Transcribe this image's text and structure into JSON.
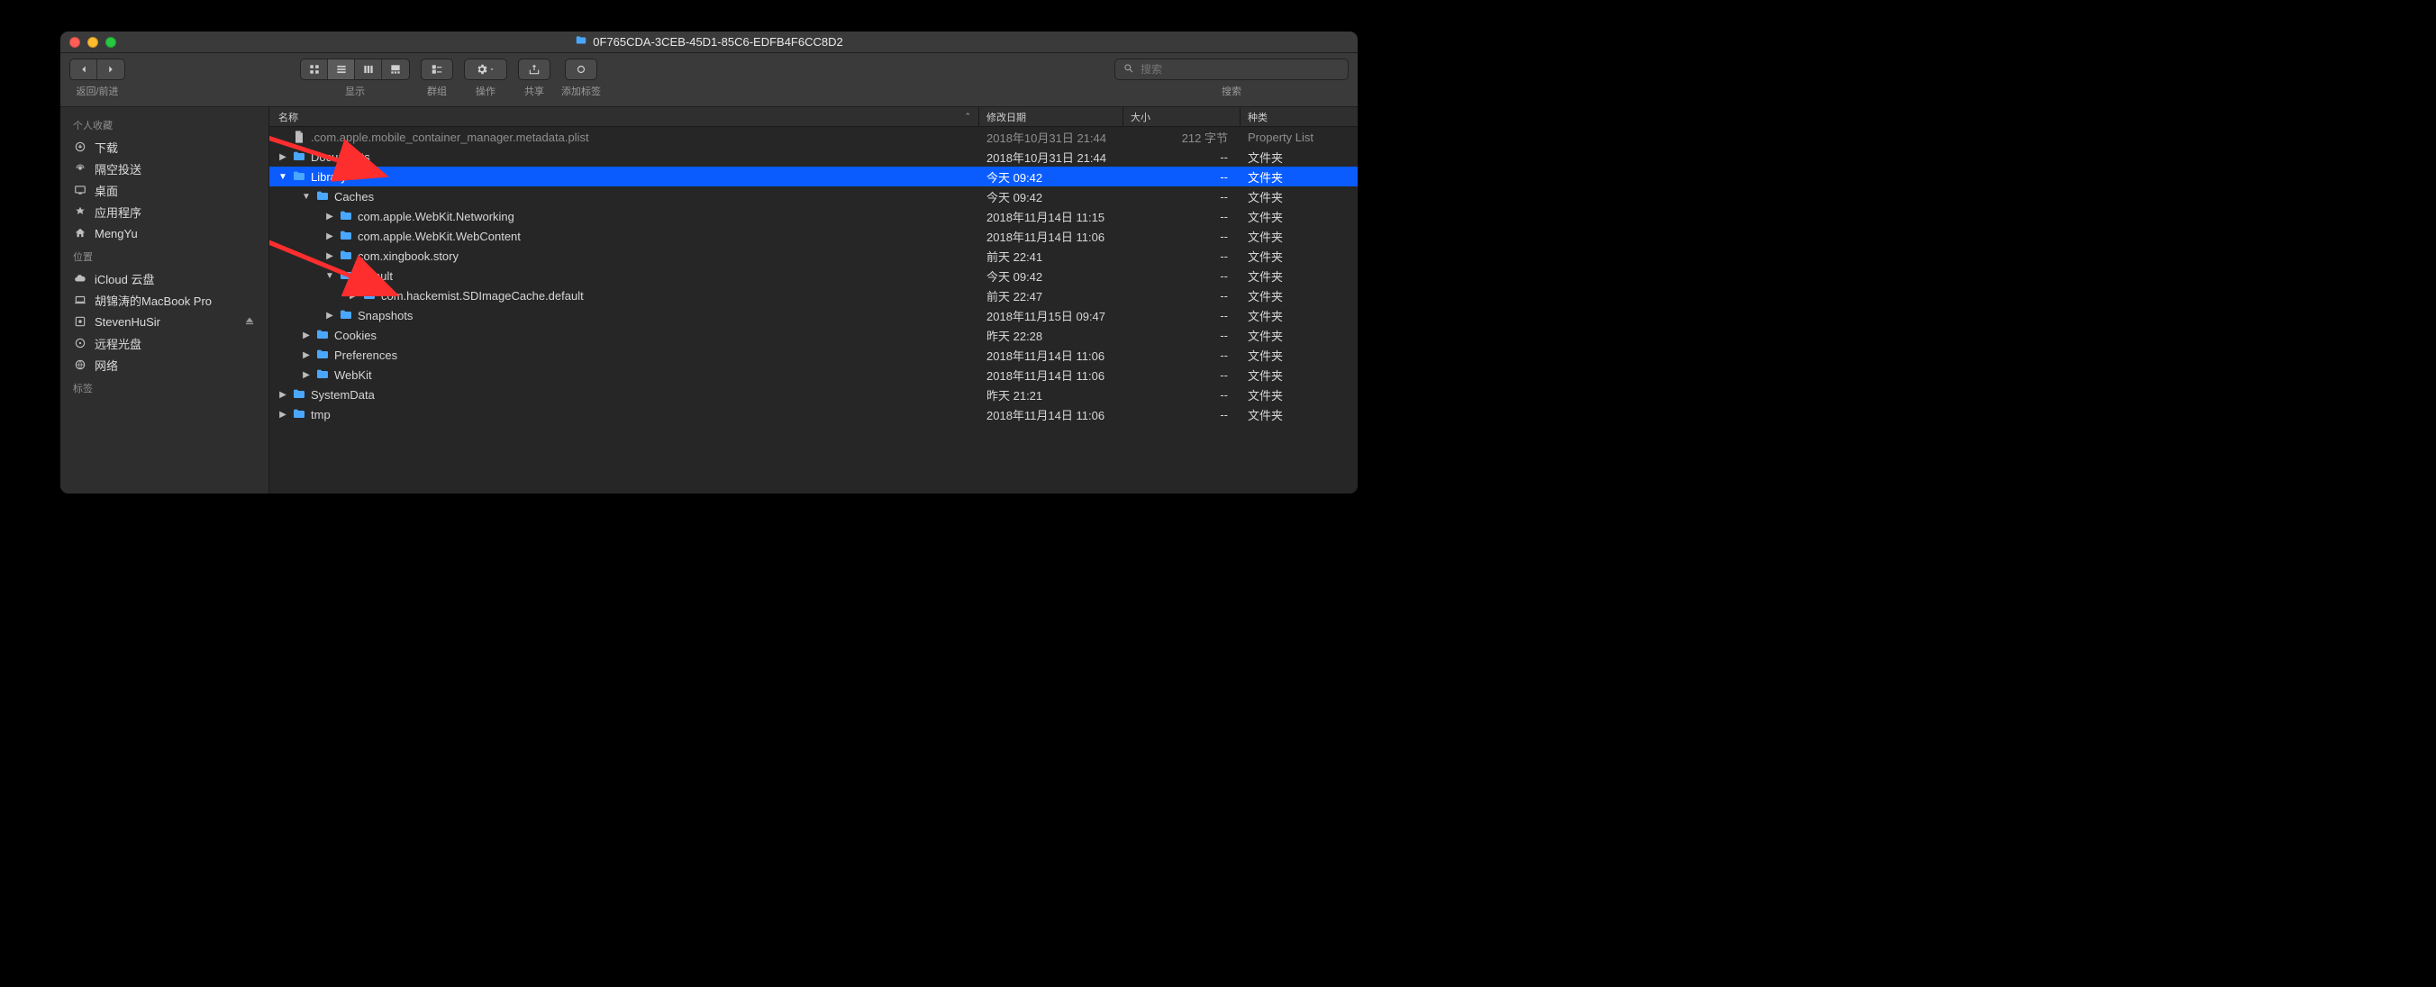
{
  "window": {
    "title": "0F765CDA-3CEB-45D1-85C6-EDFB4F6CC8D2"
  },
  "toolbar": {
    "nav_label": "返回/前进",
    "view_label": "显示",
    "group_label": "群组",
    "action_label": "操作",
    "share_label": "共享",
    "tags_label": "添加标签",
    "search_label": "搜索",
    "search_placeholder": "搜索"
  },
  "sidebar": {
    "sections": [
      {
        "title": "个人收藏",
        "items": [
          {
            "icon": "download",
            "label": "下载"
          },
          {
            "icon": "airdrop",
            "label": "隔空投送"
          },
          {
            "icon": "desktop",
            "label": "桌面"
          },
          {
            "icon": "apps",
            "label": "应用程序"
          },
          {
            "icon": "home",
            "label": "MengYu"
          }
        ]
      },
      {
        "title": "位置",
        "items": [
          {
            "icon": "cloud",
            "label": "iCloud 云盘"
          },
          {
            "icon": "laptop",
            "label": "胡锦涛的MacBook Pro"
          },
          {
            "icon": "disk",
            "label": "StevenHuSir",
            "eject": true
          },
          {
            "icon": "opticdisc",
            "label": "远程光盘"
          },
          {
            "icon": "network",
            "label": "网络"
          }
        ]
      },
      {
        "title": "标签",
        "items": []
      }
    ]
  },
  "columns": {
    "name": "名称",
    "date": "修改日期",
    "size": "大小",
    "kind": "种类"
  },
  "rows": [
    {
      "depth": 0,
      "disclosure": "",
      "type": "file",
      "name": ".com.apple.mobile_container_manager.metadata.plist",
      "date": "2018年10月31日 21:44",
      "size": "212 字节",
      "kind": "Property List",
      "dim": true
    },
    {
      "depth": 0,
      "disclosure": "right",
      "type": "folder",
      "name": "Documents",
      "date": "2018年10月31日 21:44",
      "size": "--",
      "kind": "文件夹"
    },
    {
      "depth": 0,
      "disclosure": "down",
      "type": "folder",
      "name": "Library",
      "date": "今天 09:42",
      "size": "--",
      "kind": "文件夹",
      "selected": true
    },
    {
      "depth": 1,
      "disclosure": "down",
      "type": "folder",
      "name": "Caches",
      "date": "今天 09:42",
      "size": "--",
      "kind": "文件夹"
    },
    {
      "depth": 2,
      "disclosure": "right",
      "type": "folder",
      "name": "com.apple.WebKit.Networking",
      "date": "2018年11月14日 11:15",
      "size": "--",
      "kind": "文件夹"
    },
    {
      "depth": 2,
      "disclosure": "right",
      "type": "folder",
      "name": "com.apple.WebKit.WebContent",
      "date": "2018年11月14日 11:06",
      "size": "--",
      "kind": "文件夹"
    },
    {
      "depth": 2,
      "disclosure": "right",
      "type": "folder",
      "name": "com.xingbook.story",
      "date": "前天 22:41",
      "size": "--",
      "kind": "文件夹"
    },
    {
      "depth": 2,
      "disclosure": "down",
      "type": "folder",
      "name": "default",
      "date": "今天 09:42",
      "size": "--",
      "kind": "文件夹"
    },
    {
      "depth": 3,
      "disclosure": "right",
      "type": "folder",
      "name": "com.hackemist.SDImageCache.default",
      "date": "前天 22:47",
      "size": "--",
      "kind": "文件夹"
    },
    {
      "depth": 2,
      "disclosure": "right",
      "type": "folder",
      "name": "Snapshots",
      "date": "2018年11月15日 09:47",
      "size": "--",
      "kind": "文件夹"
    },
    {
      "depth": 1,
      "disclosure": "right",
      "type": "folder",
      "name": "Cookies",
      "date": "昨天 22:28",
      "size": "--",
      "kind": "文件夹"
    },
    {
      "depth": 1,
      "disclosure": "right",
      "type": "folder",
      "name": "Preferences",
      "date": "2018年11月14日 11:06",
      "size": "--",
      "kind": "文件夹"
    },
    {
      "depth": 1,
      "disclosure": "right",
      "type": "folder",
      "name": "WebKit",
      "date": "2018年11月14日 11:06",
      "size": "--",
      "kind": "文件夹"
    },
    {
      "depth": 0,
      "disclosure": "right",
      "type": "folder",
      "name": "SystemData",
      "date": "昨天 21:21",
      "size": "--",
      "kind": "文件夹"
    },
    {
      "depth": 0,
      "disclosure": "right",
      "type": "folder",
      "name": "tmp",
      "date": "2018年11月14日 11:06",
      "size": "--",
      "kind": "文件夹"
    }
  ],
  "colors": {
    "select": "#0a5cff",
    "folder": "#4aa7ff",
    "arrow": "#ff2e2e"
  }
}
